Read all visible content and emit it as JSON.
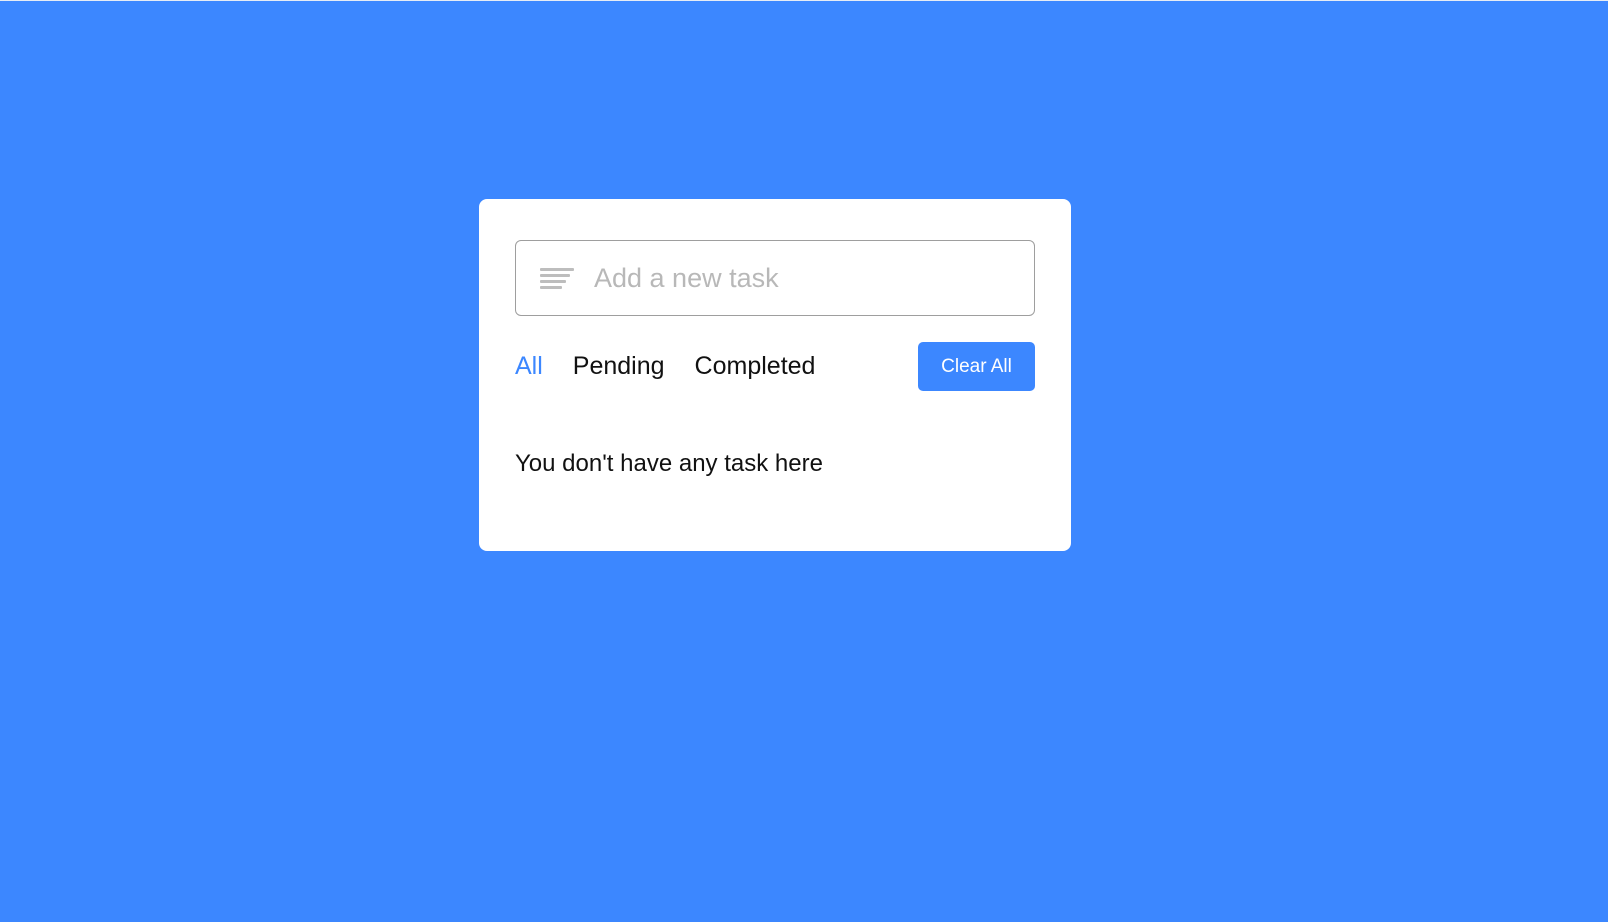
{
  "colors": {
    "background": "#3c87ff",
    "accent": "#3c87ff",
    "card": "#ffffff",
    "placeholder": "#b8b8b8",
    "text": "#111111"
  },
  "task_input": {
    "icon": "menu-lines-icon",
    "placeholder": "Add a new task",
    "value": ""
  },
  "filters": {
    "tabs": [
      {
        "label": "All",
        "active": true
      },
      {
        "label": "Pending",
        "active": false
      },
      {
        "label": "Completed",
        "active": false
      }
    ]
  },
  "actions": {
    "clear_all_label": "Clear All"
  },
  "task_list": {
    "empty_message": "You don't have any task here"
  }
}
